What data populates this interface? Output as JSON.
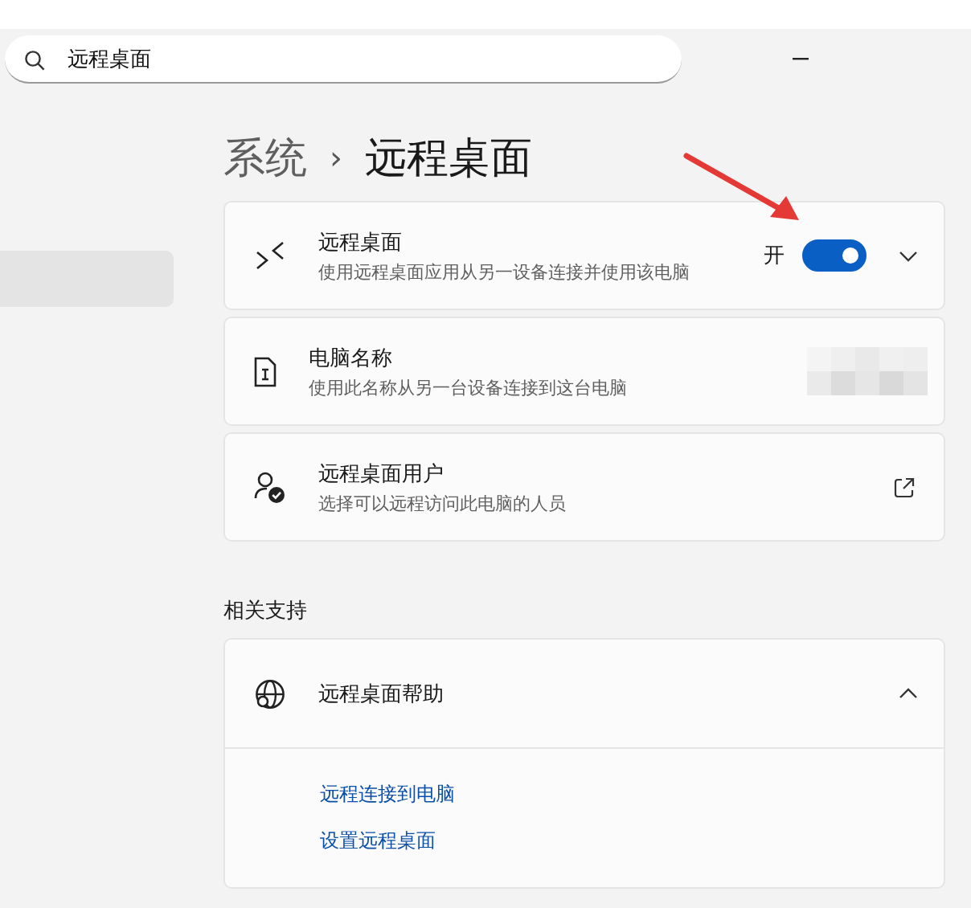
{
  "search": {
    "value": "远程桌面"
  },
  "sidebar": {
    "items": [
      {
        "selected": true
      }
    ]
  },
  "breadcrumb": {
    "parent": "系统",
    "separator": "›",
    "current": "远程桌面"
  },
  "settings": [
    {
      "kind": "toggle",
      "title": "远程桌面",
      "description": "使用远程桌面应用从另一设备连接并使用该电脑",
      "state_label": "开",
      "on": true,
      "expanded": false
    },
    {
      "kind": "redacted",
      "title": "电脑名称",
      "description": "使用此名称从另一台设备连接到这台电脑"
    },
    {
      "kind": "external",
      "title": "远程桌面用户",
      "description": "选择可以远程访问此电脑的人员"
    }
  ],
  "related": {
    "heading": "相关支持",
    "title": "远程桌面帮助",
    "expanded": true,
    "links": [
      "远程连接到电脑",
      "设置远程桌面"
    ]
  }
}
